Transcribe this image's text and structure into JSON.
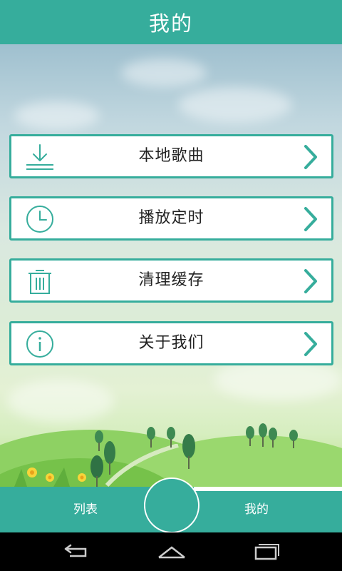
{
  "header": {
    "title": "我的"
  },
  "menu": [
    {
      "label": "本地歌曲",
      "icon": "download-icon"
    },
    {
      "label": "播放定时",
      "icon": "clock-icon"
    },
    {
      "label": "清理缓存",
      "icon": "trash-icon"
    },
    {
      "label": "关于我们",
      "icon": "info-icon"
    }
  ],
  "bottom_nav": {
    "left_label": "列表",
    "right_label": "我的",
    "center": "center-circle-button"
  },
  "system_nav": [
    "back-icon",
    "home-icon",
    "recents-icon"
  ],
  "colors": {
    "accent": "#36ad9c",
    "text": "#222222",
    "background": "#ffffff"
  }
}
